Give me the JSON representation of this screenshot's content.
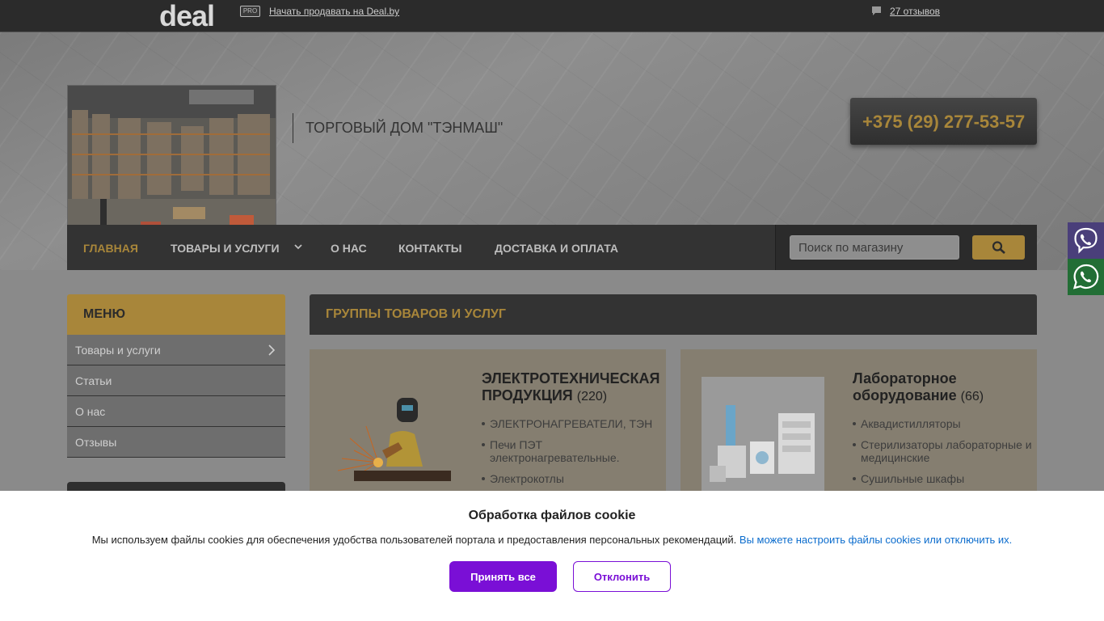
{
  "topbar": {
    "logo_text": "deal",
    "pro_badge": "PRO",
    "sell_link": "Начать продавать на Deal.by",
    "reviews_link": "27 отзывов"
  },
  "header": {
    "company_name": "ТОРГОВЫЙ ДОМ \"ТЭНМАШ\"",
    "phone": "+375 (29) 277-53-57"
  },
  "nav": {
    "items": [
      "ГЛАВНАЯ",
      "ТОВАРЫ И УСЛУГИ",
      "О НАС",
      "КОНТАКТЫ",
      "ДОСТАВКА И ОПЛАТА"
    ],
    "active": "ГЛАВНАЯ",
    "search_placeholder": "Поиск по магазину"
  },
  "sidebar": {
    "title": "МЕНЮ",
    "items": [
      "Товары и услуги",
      "Статьи",
      "О нас",
      "Отзывы"
    ]
  },
  "catalog": {
    "title": "ГРУППЫ ТОВАРОВ И УСЛУГ",
    "groups": [
      {
        "title": "ЭЛЕКТРОТЕХНИЧЕСКАЯ ПРОДУКЦИЯ",
        "count": "(220)",
        "items": [
          "ЭЛЕКТРОНАГРЕВАТЕЛИ, ТЭН",
          "Печи ПЭТ электронагревательные.",
          "Электрокотлы"
        ]
      },
      {
        "title": "Лабораторное оборудование",
        "count": "(66)",
        "items": [
          "Аквадистилляторы",
          "Стерилизаторы лабораторные и медицинские",
          "Сушильные шкафы"
        ]
      }
    ]
  },
  "cookie": {
    "title": "Обработка файлов cookie",
    "text": "Мы используем файлы cookies для обеспечения удобства пользователей портала и предоставления персональных рекомендаций.",
    "link": "Вы можете настроить файлы cookies или отключить их.",
    "accept": "Принять все",
    "decline": "Отклонить"
  },
  "colors": {
    "accent": "#a8863a",
    "dark": "#333333",
    "cookie_button": "#7a0fd6",
    "viber": "#4a3f7a",
    "whatsapp": "#226e35"
  },
  "icons": [
    "comment-icon",
    "chevron-down-icon",
    "search-icon",
    "viber-icon",
    "whatsapp-icon",
    "chevron-right-icon"
  ]
}
